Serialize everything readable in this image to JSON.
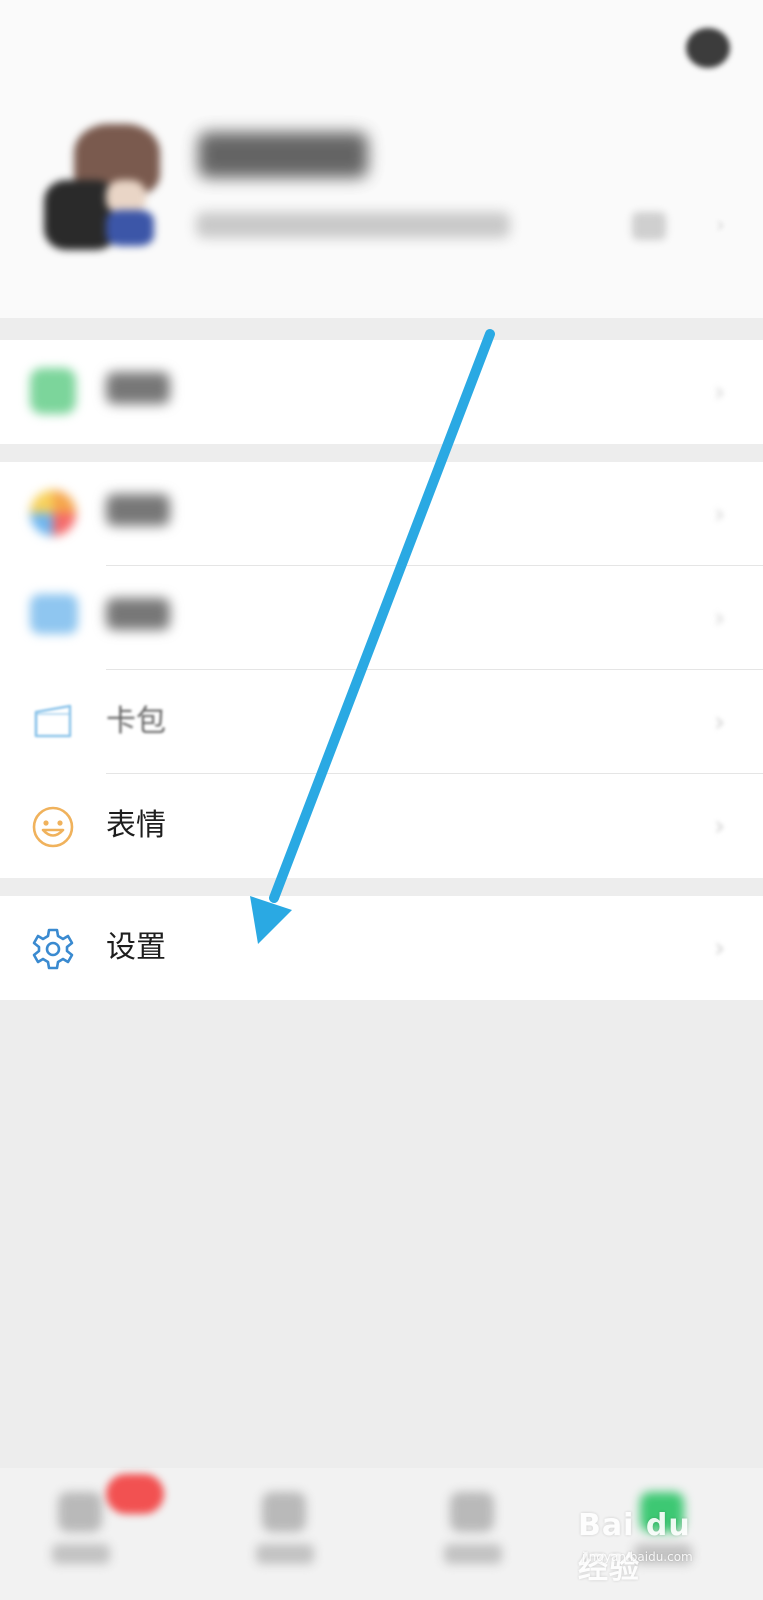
{
  "colors": {
    "page_bg": "#ededed",
    "row_bg": "#ffffff",
    "arrow": "#2aa9e3",
    "emoji_icon": "#f0b25c",
    "settings_icon": "#3a8ad0",
    "card_icon": "#8ec5ea",
    "badge": "#f25151"
  },
  "menu": {
    "card_pack": {
      "label": "卡包",
      "icon": "card-icon"
    },
    "stickers": {
      "label": "表情",
      "icon": "smiley-icon"
    },
    "settings": {
      "label": "设置",
      "icon": "gear-icon"
    },
    "chevron": "›"
  },
  "watermark": {
    "brand": "Bai du 经验",
    "url": "jingyan.baidu.com"
  }
}
